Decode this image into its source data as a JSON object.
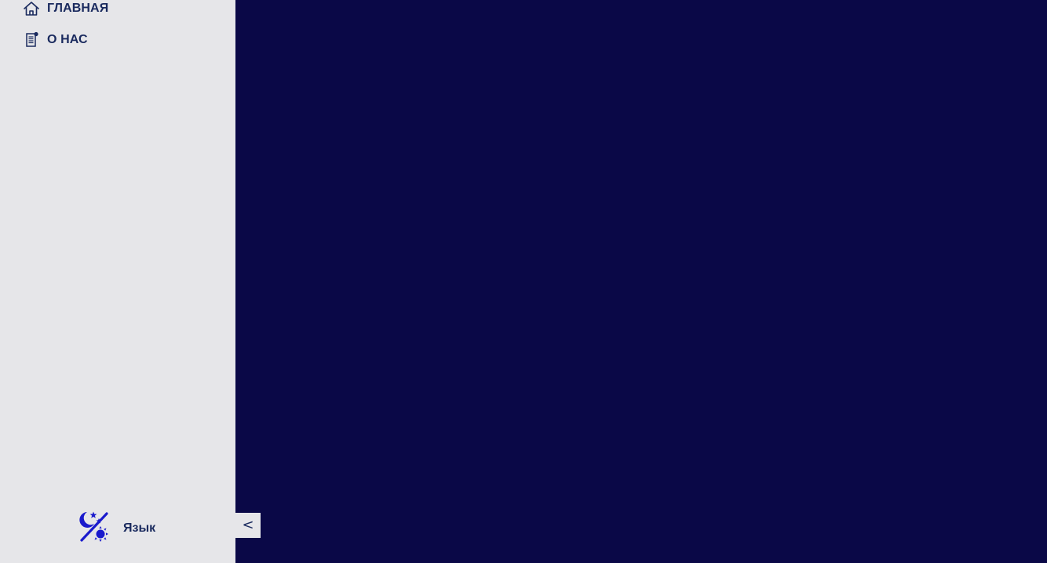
{
  "sidebar": {
    "items": [
      {
        "label": "ГЛАВНАЯ",
        "icon": "home-icon"
      },
      {
        "label": "О НАС",
        "icon": "document-icon"
      }
    ],
    "language_label": "Язык",
    "theme_icon": "theme-toggle-icon"
  },
  "collapse_button": {
    "label": "<"
  },
  "colors": {
    "sidebar_bg": "#e6e6e9",
    "main_bg": "#0a0847",
    "text": "#1a2a5e",
    "accent": "#1a1acc"
  }
}
